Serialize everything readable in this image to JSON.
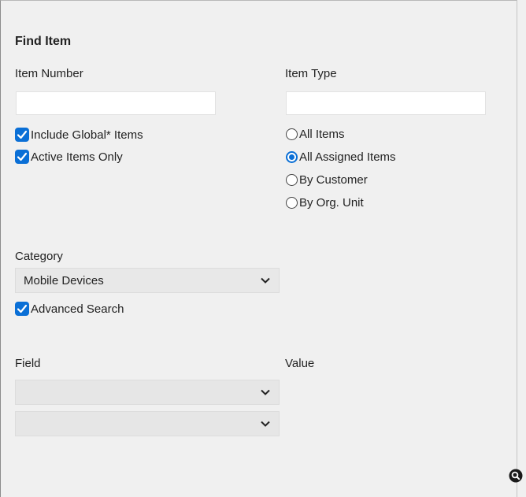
{
  "panel": {
    "title": "Find Item",
    "item_number": {
      "label": "Item Number",
      "value": ""
    },
    "item_type": {
      "label": "Item Type",
      "value": ""
    },
    "checkboxes": [
      {
        "label": "Include Global* Items",
        "checked": true
      },
      {
        "label": "Active Items Only",
        "checked": true
      }
    ],
    "radios": [
      {
        "label": "All Items",
        "selected": false
      },
      {
        "label": "All Assigned Items",
        "selected": true
      },
      {
        "label": "By Customer",
        "selected": false
      },
      {
        "label": "By Org. Unit",
        "selected": false
      }
    ],
    "category": {
      "label": "Category",
      "selected": "Mobile Devices"
    },
    "advanced_search": {
      "label": "Advanced Search",
      "checked": true
    },
    "field_label": "Field",
    "value_label": "Value",
    "field_selects": [
      {
        "selected": ""
      },
      {
        "selected": ""
      }
    ]
  },
  "colors": {
    "accent": "#0a6fd6",
    "background": "#f0f0f0"
  },
  "icons": {
    "search": "magnifier-icon",
    "check": "check-icon",
    "chevron": "chevron-down-icon"
  }
}
